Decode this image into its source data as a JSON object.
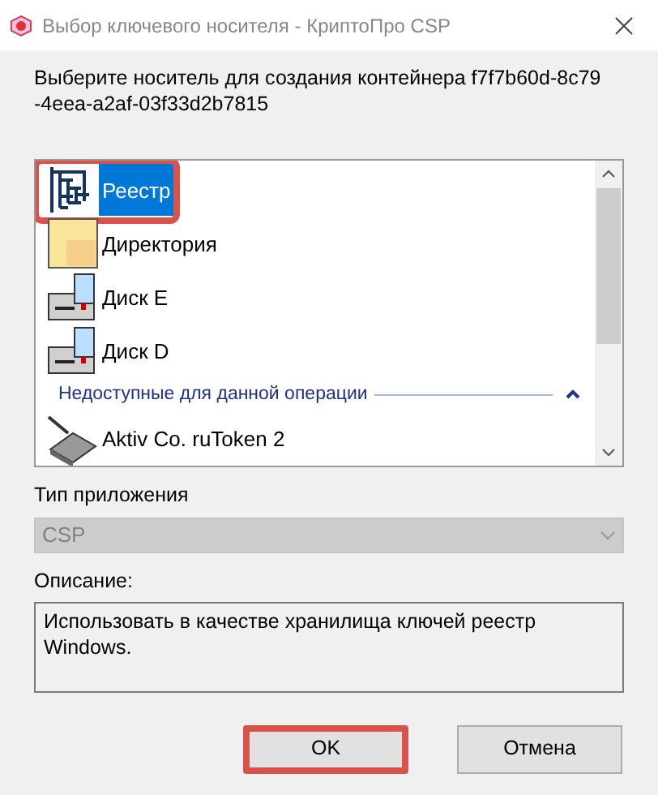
{
  "window": {
    "title": "Выбор ключевого носителя - КриптоПро CSP"
  },
  "prompt": "Выберите носитель для создания контейнера f7f7b60d-8c79 -4eea-a2af-03f33d2b7815",
  "media": [
    {
      "kind": "registry",
      "label": "Реестр",
      "selected": true,
      "highlighted": true
    },
    {
      "kind": "folder",
      "label": "Директория",
      "selected": false,
      "highlighted": false
    },
    {
      "kind": "disk",
      "label": "Диск E",
      "selected": false,
      "highlighted": false
    },
    {
      "kind": "disk",
      "label": "Диск D",
      "selected": false,
      "highlighted": false
    },
    {
      "kind": "group",
      "label": "Недоступные для данной операции",
      "expanded": true
    },
    {
      "kind": "token",
      "label": "Aktiv Co. ruToken 2",
      "selected": false,
      "highlighted": false
    }
  ],
  "app_type": {
    "label": "Тип приложения",
    "value": "CSP",
    "disabled": true
  },
  "description": {
    "label": "Описание:",
    "value": "Использовать в качестве хранилища ключей реестр Windows."
  },
  "buttons": [
    {
      "label": "OK",
      "highlighted": true
    },
    {
      "label": "Отмена",
      "highlighted": false
    }
  ]
}
